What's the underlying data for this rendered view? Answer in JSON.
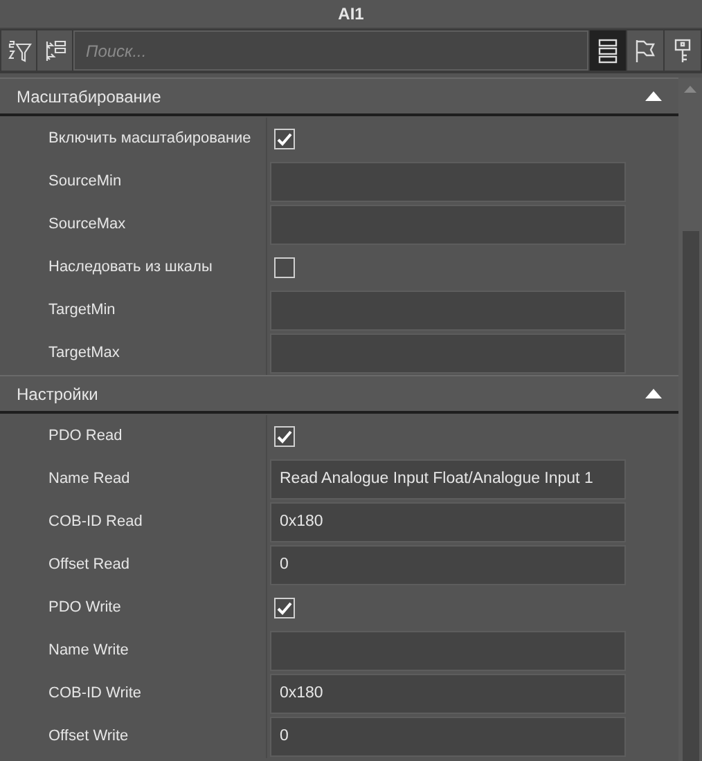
{
  "window": {
    "title": "AI1"
  },
  "toolbar": {
    "search": {
      "placeholder": "Поиск..."
    },
    "views": [
      {
        "kind": "list",
        "selected": true
      },
      {
        "kind": "flag",
        "selected": false
      },
      {
        "kind": "key",
        "selected": false
      }
    ]
  },
  "sections": [
    {
      "title": "Масштабирование",
      "expanded": true,
      "rows": [
        {
          "label": "Включить масштабирование",
          "kind": "checkbox",
          "checked": true
        },
        {
          "label": "SourceMin",
          "kind": "text"
        },
        {
          "label": "SourceMax",
          "kind": "text"
        },
        {
          "label": "Наследовать из шкалы",
          "kind": "checkbox",
          "checked": false
        },
        {
          "label": "TargetMin",
          "kind": "text"
        },
        {
          "label": "TargetMax",
          "kind": "text"
        }
      ]
    },
    {
      "title": "Настройки",
      "expanded": true,
      "rows": [
        {
          "label": "PDO Read",
          "kind": "checkbox",
          "checked": true
        },
        {
          "label": "Name Read",
          "kind": "text",
          "value": "Read Analogue Input Float/Analogue Input 1"
        },
        {
          "label": "COB-ID Read",
          "kind": "text",
          "value": "0x180"
        },
        {
          "label": "Offset Read",
          "kind": "text",
          "value": "0"
        },
        {
          "label": "PDO Write",
          "kind": "checkbox",
          "checked": true
        },
        {
          "label": "Name Write",
          "kind": "text"
        },
        {
          "label": "COB-ID Write",
          "kind": "text",
          "value": "0x180"
        },
        {
          "label": "Offset Write",
          "kind": "text",
          "value": "0"
        }
      ]
    }
  ]
}
